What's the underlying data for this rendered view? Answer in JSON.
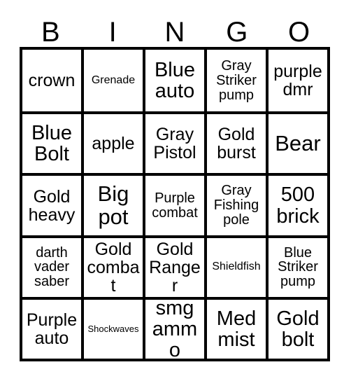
{
  "card": {
    "title": "BINGO",
    "header_letters": [
      "B",
      "I",
      "N",
      "G",
      "O"
    ],
    "columns": 5,
    "rows": 5,
    "colors": {
      "background": "#ffffff",
      "border": "#000000",
      "text": "#000000",
      "cell_background": "#ffffff"
    },
    "cells": [
      [
        {
          "text": "crown",
          "size": "md"
        },
        {
          "text": "Grenade",
          "size": "xs"
        },
        {
          "text": "Blue auto",
          "size": "lg"
        },
        {
          "text": "Gray Striker pump",
          "size": "sm"
        },
        {
          "text": "purple dmr",
          "size": "md"
        }
      ],
      [
        {
          "text": "Blue Bolt",
          "size": "lg"
        },
        {
          "text": "apple",
          "size": "md"
        },
        {
          "text": "Gray Pistol",
          "size": "md"
        },
        {
          "text": "Gold burst",
          "size": "md"
        },
        {
          "text": "Bear",
          "size": "xl"
        }
      ],
      [
        {
          "text": "Gold heavy",
          "size": "md"
        },
        {
          "text": "Big pot",
          "size": "xl"
        },
        {
          "text": "Purple combat",
          "size": "sm"
        },
        {
          "text": "Gray Fishing pole",
          "size": "sm"
        },
        {
          "text": "500 brick",
          "size": "lg"
        }
      ],
      [
        {
          "text": "darth vader saber",
          "size": "sm"
        },
        {
          "text": "Gold combat",
          "size": "md"
        },
        {
          "text": "Gold Ranger",
          "size": "md"
        },
        {
          "text": "Shieldfish",
          "size": "xs"
        },
        {
          "text": "Blue Striker pump",
          "size": "sm"
        }
      ],
      [
        {
          "text": "Purple auto",
          "size": "md"
        },
        {
          "text": "Shockwaves",
          "size": "xxs"
        },
        {
          "text": "smg ammo",
          "size": "lg"
        },
        {
          "text": "Med mist",
          "size": "lg"
        },
        {
          "text": "Gold bolt",
          "size": "lg"
        }
      ]
    ]
  }
}
